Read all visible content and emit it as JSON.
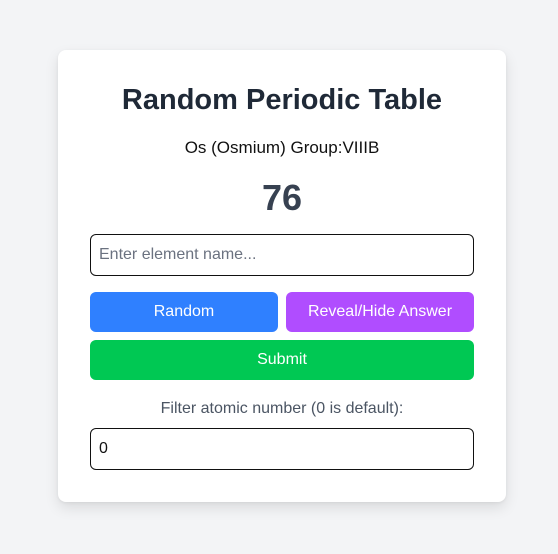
{
  "app": {
    "title": "Random Periodic Table"
  },
  "element": {
    "info": "Os (Osmium) Group:VIIIB",
    "atomic_number": "76"
  },
  "answer_input": {
    "placeholder": "Enter element name...",
    "value": ""
  },
  "buttons": {
    "random_label": "Random",
    "reveal_label": "Reveal/Hide Answer",
    "submit_label": "Submit"
  },
  "filter": {
    "label": "Filter atomic number (0 is default):",
    "value": "0"
  },
  "colors": {
    "background": "#f3f4f6",
    "card": "#ffffff",
    "random_button": "#2f80ff",
    "reveal_button": "#b04dff",
    "submit_button": "#00c853",
    "title_text": "#1f2937"
  }
}
